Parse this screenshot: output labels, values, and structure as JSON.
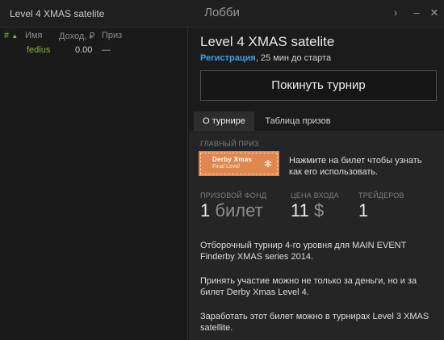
{
  "window": {
    "title": "Level 4 XMAS satelite",
    "center_title": "Лобби",
    "btn_next": "›",
    "btn_min": "–",
    "btn_close": "✕"
  },
  "players": {
    "columns": {
      "hash": "#",
      "arrow": "▲",
      "name": "Имя",
      "income": "Доход, ₽",
      "prize": "Приз"
    },
    "rows": [
      {
        "name": "fedius",
        "income": "0.00",
        "prize": "—"
      }
    ]
  },
  "tournament": {
    "title": "Level 4 XMAS satelite",
    "status_reg": "Регистрация",
    "status_rest": ", 25 мин до старта",
    "leave_button": "Покинуть турнир",
    "tabs": [
      "О турнире",
      "Таблица призов"
    ],
    "main_prize_label": "ГЛАВНЫЙ ПРИЗ",
    "ticket": {
      "line1": "Derby Xmas",
      "line2": "Final Level",
      "icon": "snowflake-icon"
    },
    "ticket_hint": "Нажмите на билет чтобы узнать как его использовать.",
    "stats": [
      {
        "label": "ПРИЗОВОЙ ФОНД",
        "value": "1",
        "unit": "билет"
      },
      {
        "label": "ЦЕНА ВХОДА",
        "value": "11",
        "unit": "$"
      },
      {
        "label": "ТРЕЙДЕРОВ",
        "value": "1",
        "unit": ""
      }
    ],
    "description": [
      "Отборочный турнир 4-го уровня для MAIN EVENT Finderby XMAS series 2014.",
      "Принять участие можно не только за деньги, но и за билет Derby Xmas Level 4.",
      "Заработать этот билет можно в турнирах Level 3 XMAS satellite."
    ]
  },
  "colors": {
    "accent_green": "#8ab23a",
    "accent_blue": "#3ea0e4",
    "ticket_orange": "#e0874f",
    "background": "#1b1b1b"
  }
}
